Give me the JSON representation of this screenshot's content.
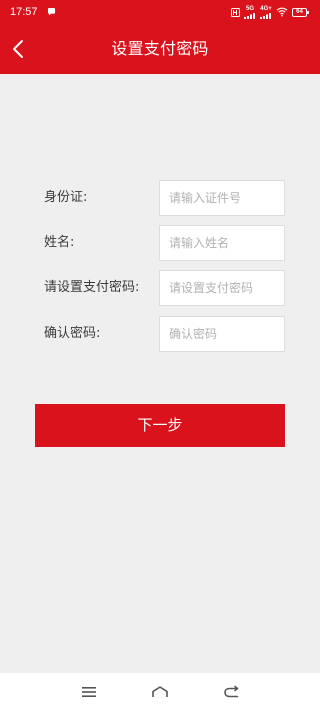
{
  "status_bar": {
    "time": "17:57",
    "network_badge_1": "5G",
    "network_badge_2": "4G+",
    "battery": "64"
  },
  "header": {
    "title": "设置支付密码"
  },
  "form": {
    "id_label": "身份证:",
    "id_placeholder": "请输入证件号",
    "name_label": "姓名:",
    "name_placeholder": "请输入姓名",
    "pay_password_label": "请设置支付密码:",
    "pay_password_placeholder": "请设置支付密码",
    "confirm_password_label": "确认密码:",
    "confirm_password_placeholder": "确认密码"
  },
  "actions": {
    "next_label": "下一步"
  },
  "colors": {
    "accent": "#d9121c",
    "background": "#efefef"
  },
  "icons": {
    "back": "chevron-left-icon",
    "chat": "message-bubble-icon",
    "menu": "menu-icon",
    "home": "home-icon",
    "nav_back": "back-arrow-icon"
  }
}
